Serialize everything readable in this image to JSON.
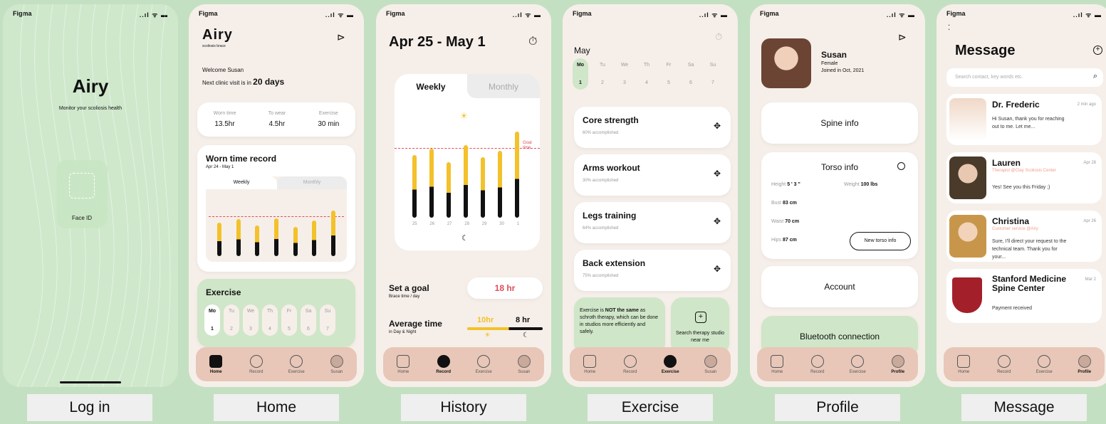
{
  "status_bar": {
    "carrier": "Figma",
    "signals": "..ıl ᯤ ▬"
  },
  "captions": [
    "Log in",
    "Home",
    "History",
    "Exercise",
    "Profile",
    "Message"
  ],
  "login": {
    "app_name": "Airy",
    "tagline": "Monitor your scoliosis health",
    "faceid_label": "Face ID"
  },
  "home": {
    "logo": "Airy",
    "logo_sub": "scoliosis brace",
    "welcome": "Welcome Susan",
    "next_visit_prefix": "Next clinic visit is in",
    "next_visit_days": "20 days",
    "stats": [
      {
        "label": "Worn time",
        "value": "13.5hr"
      },
      {
        "label": "To wear",
        "value": "4.5hr"
      },
      {
        "label": "Exercise",
        "value": "30 min"
      }
    ],
    "record_title": "Worn time record",
    "record_range": "Apr 24 - May 1",
    "tab_weekly": "Weekly",
    "tab_monthly": "Monthly",
    "bar_fills": [
      0.55,
      0.6,
      0.5,
      0.62,
      0.48,
      0.58,
      0.75
    ],
    "exercise_title": "Exercise",
    "days": [
      {
        "d": "Mo",
        "n": "1"
      },
      {
        "d": "Tu",
        "n": "2"
      },
      {
        "d": "We",
        "n": "3"
      },
      {
        "d": "Th",
        "n": "4"
      },
      {
        "d": "Fr",
        "n": "5"
      },
      {
        "d": "Sa",
        "n": "6"
      },
      {
        "d": "Su",
        "n": "7"
      }
    ]
  },
  "history": {
    "range": "Apr 25 - May 1",
    "tab_weekly": "Weekly",
    "tab_monthly": "Monthly",
    "goal_label": "Goal time",
    "bar_fills": [
      0.62,
      0.68,
      0.55,
      0.72,
      0.6,
      0.66,
      0.85
    ],
    "x_labels": [
      "25",
      "26",
      "27",
      "28",
      "29",
      "30",
      "1"
    ],
    "set_goal": "Set a goal",
    "set_goal_sub": "Brace time / day",
    "goal_value": "18 hr",
    "avg_time": "Average time",
    "avg_sub": "in Day & Night",
    "day_value": "10hr",
    "night_value": "8 hr"
  },
  "exercise": {
    "month": "May",
    "days": [
      {
        "d": "Mo",
        "n": "1"
      },
      {
        "d": "Tu",
        "n": "2"
      },
      {
        "d": "We",
        "n": "3"
      },
      {
        "d": "Th",
        "n": "4"
      },
      {
        "d": "Fr",
        "n": "5"
      },
      {
        "d": "Sa",
        "n": "6"
      },
      {
        "d": "Su",
        "n": "7"
      }
    ],
    "items": [
      {
        "name": "Core strength",
        "pct": "60% accomplished"
      },
      {
        "name": "Arms workout",
        "pct": "30% accomplished"
      },
      {
        "name": "Legs training",
        "pct": "64% accomplished"
      },
      {
        "name": "Back extension",
        "pct": "75% accomplished"
      }
    ],
    "note_pre": "Exercise is ",
    "note_bold": "NOT the same",
    "note_post": " as schroth therapy, which can be done in studios more efficiently and safely.",
    "search_label": "Search therapy studio near me"
  },
  "profile": {
    "name": "Susan",
    "gender": "Female",
    "joined": "Joined in Oct, 2021",
    "spine": "Spine info",
    "torso": "Torso info",
    "height_label": "Height",
    "height": "5 ' 3 \"",
    "weight_label": "Weight",
    "weight": "100 lbs",
    "bust_label": "Bust",
    "bust": "83 cm",
    "waist_label": "Waist",
    "waist": "70 cm",
    "hips_label": "Hips",
    "hips": "87 cm",
    "new_torso": "New torso info",
    "account": "Account",
    "bluetooth": "Bluetooth connection"
  },
  "message": {
    "title": "Message",
    "search_placeholder": "Search contact, key words etc.",
    "items": [
      {
        "name": "Dr. Frederic",
        "time": "2 min ago",
        "sub": "",
        "text": "Hi Susan, thank you for reaching out to me. Let me..."
      },
      {
        "name": "Lauren",
        "time": "Apr 28",
        "sub": "Therapist @Clay Scoliosis Center",
        "text": "Yes! See you this Friday ;)"
      },
      {
        "name": "Christina",
        "time": "Apr 26",
        "sub": "Customer service @Airy",
        "text": "Sure, I'll direct your request to the technical team. Thank you for your..."
      },
      {
        "name": "Stanford Medicine Spine Center",
        "time": "Mar 2",
        "sub": "",
        "text": "Payment received"
      }
    ]
  },
  "tabs": {
    "home": "Home",
    "record": "Record",
    "exercise": "Exercise",
    "user": "Susan",
    "profile": "Profile"
  },
  "colors": {
    "bg": "#c4e0c2",
    "cream": "#f6efe9",
    "green": "#cfe6c8",
    "tabbar": "#e8c7b8",
    "accent": "#f3c12a",
    "goal": "#e04b5a"
  }
}
